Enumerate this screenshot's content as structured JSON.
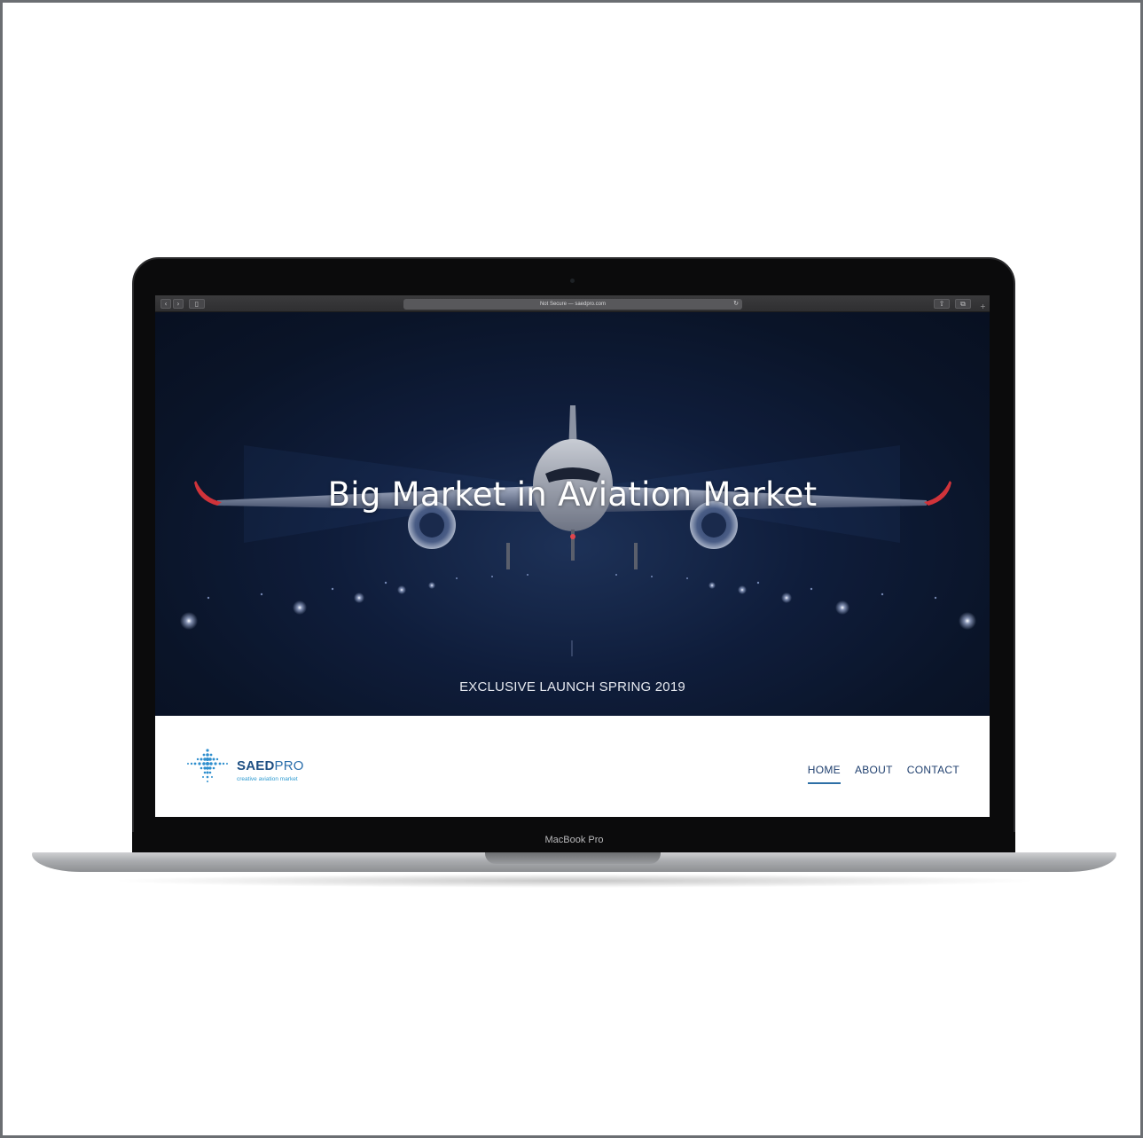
{
  "device": {
    "brand_label": "MacBook Pro"
  },
  "browser": {
    "address_text": "Not Secure — saedpro.com",
    "icons": [
      "back-icon",
      "forward-icon",
      "sidebar-icon",
      "reload-icon",
      "share-icon",
      "tabs-icon",
      "new-tab-icon"
    ]
  },
  "hero": {
    "title": "Big Market in Aviation Market",
    "subtitle": "EXCLUSIVE LAUNCH SPRING 2019"
  },
  "site": {
    "logo": {
      "name_bold": "SAED",
      "name_light": "PRO",
      "tagline": "creative aviation market"
    },
    "nav": [
      {
        "label": "HOME",
        "active": true
      },
      {
        "label": "ABOUT",
        "active": false
      },
      {
        "label": "CONTACT",
        "active": false
      }
    ]
  },
  "colors": {
    "hero_bg": "#0f1d3b",
    "nav_text": "#1f3f6e",
    "accent": "#2d6fa6",
    "logo_blue": "#1e4f83"
  }
}
